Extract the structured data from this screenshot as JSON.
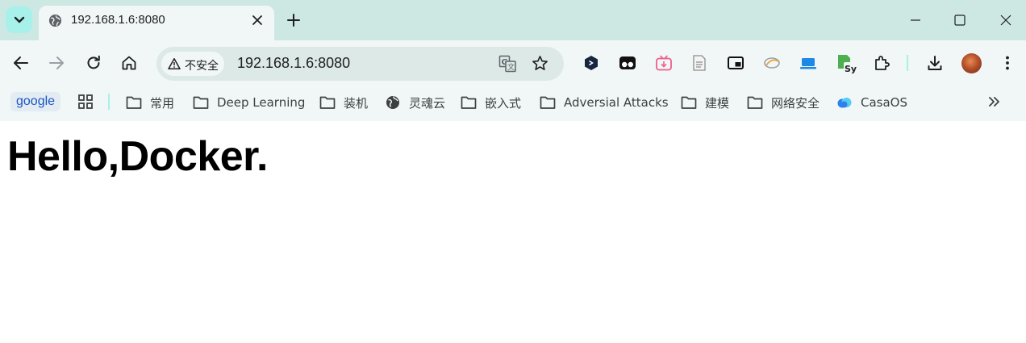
{
  "tab": {
    "title": "192.168.1.6:8080"
  },
  "omnibox": {
    "security_label": "不安全",
    "url": "192.168.1.6:8080"
  },
  "bookmarks": [
    {
      "label": "google"
    },
    {
      "label": "常用"
    },
    {
      "label": "Deep Learning"
    },
    {
      "label": "装机"
    },
    {
      "label": "灵魂云"
    },
    {
      "label": "嵌入式"
    },
    {
      "label": "Adversial Attacks"
    },
    {
      "label": "建模"
    },
    {
      "label": "网络安全"
    },
    {
      "label": "CasaOS"
    }
  ],
  "page": {
    "heading": "Hello,Docker."
  },
  "icons": {
    "tab_search": "chevron-down-icon",
    "favicon": "globe-icon",
    "security": "warning-triangle-icon",
    "translate": "translate-icon",
    "bookmark": "star-icon",
    "download": "download-icon",
    "menu": "three-dots-icon"
  },
  "colors": {
    "tabstrip": "#cde8e2",
    "toolbar": "#f1f7f6",
    "accent": "#a8f0ea",
    "link": "#1a56c4"
  }
}
